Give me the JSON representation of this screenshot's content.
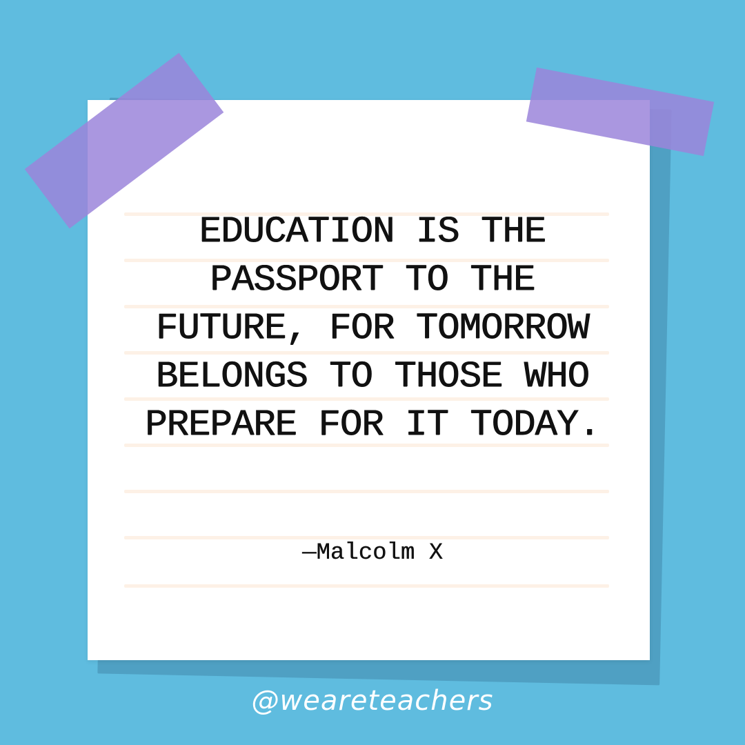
{
  "colors": {
    "background": "#5fbcdf",
    "paper": "#ffffff",
    "paper_shadow": "#4fa0c3",
    "ruled_line": "#fdf1e6",
    "tape": "#9b85db",
    "text": "#111111",
    "handle": "#ffffff"
  },
  "quote": {
    "lines": [
      "EDUCATION IS THE",
      "PASSPORT TO THE",
      "FUTURE, FOR TOMORROW",
      "BELONGS TO THOSE WHO",
      "PREPARE FOR IT TODAY."
    ],
    "author": "—Malcolm X"
  },
  "footer": {
    "handle": "@weareteachers"
  }
}
